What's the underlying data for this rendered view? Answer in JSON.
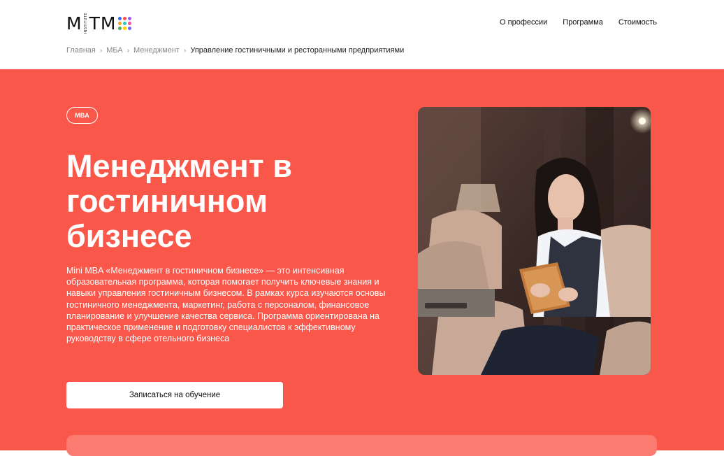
{
  "header": {
    "logo": {
      "text_left": "M",
      "text_right": "TM",
      "sub": "INSTITUTE",
      "dot_colors": [
        "#2f6bff",
        "#ff4d4d",
        "#9b5cff",
        "#ff9f1c",
        "#2ec4b6",
        "#ff4d9d",
        "#4caf50",
        "#ffcc00",
        "#7b61ff"
      ]
    },
    "nav": [
      {
        "label": "О профессии"
      },
      {
        "label": "Программа"
      },
      {
        "label": "Стоимость"
      }
    ],
    "breadcrumb": [
      {
        "label": "Главная"
      },
      {
        "label": "МБА"
      },
      {
        "label": "Менеджмент"
      },
      {
        "label": "Управление гостиничными и ресторанными предприятиями"
      }
    ],
    "breadcrumb_separator": "›"
  },
  "hero": {
    "background_color": "#fa574b",
    "badge": "MBA",
    "title": "Менеджмент в гостиничном бизнесе",
    "description": "Mini MBA «Менеджмент в гостиничном бизнесе» — это интенсивная образовательная программа, которая помогает получить ключевые знания и навыки управления гостиничным бизнесом. В рамках курса изучаются основы гостиничного менеджмента, маркетинг, работа с персоналом, финансовое планирование и улучшение качества сервиса. Программа ориентирована на практическое применение и подготовку специалистов к эффективному руководству в сфере отельного бизнеса",
    "cta_label": "Записаться на обучение",
    "photo_subject": "woman-with-tablet-in-hotel-lounge"
  }
}
